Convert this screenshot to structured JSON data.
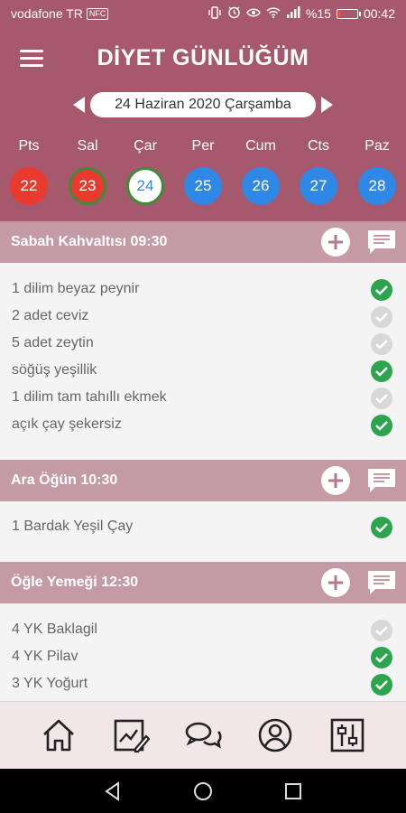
{
  "status_bar": {
    "carrier": "vodafone TR",
    "nfc_badge": "NFC",
    "battery": "%15",
    "battery_level": 0.15,
    "time": "00:42"
  },
  "header": {
    "title": "DİYET GÜNLÜĞÜM",
    "date": "24 Haziran 2020 Çarşamba"
  },
  "week": {
    "labels": [
      "Pts",
      "Sal",
      "Çar",
      "Per",
      "Cum",
      "Cts",
      "Paz"
    ],
    "days": [
      "22",
      "23",
      "24",
      "25",
      "26",
      "27",
      "28"
    ]
  },
  "meals": [
    {
      "title": "Sabah Kahvaltısı 09:30",
      "items": [
        {
          "text": "1 dilim beyaz peynir",
          "checked": true
        },
        {
          "text": "2 adet ceviz",
          "checked": false
        },
        {
          "text": "5 adet zeytin",
          "checked": false
        },
        {
          "text": "söğüş yeşillik",
          "checked": true
        },
        {
          "text": "1 dilim tam tahıllı ekmek",
          "checked": false
        },
        {
          "text": "açık çay şekersiz",
          "checked": true
        }
      ]
    },
    {
      "title": "Ara Öğün 10:30",
      "items": [
        {
          "text": "1 Bardak Yeşil Çay",
          "checked": true
        }
      ]
    },
    {
      "title": "Öğle Yemeği 12:30",
      "items": [
        {
          "text": "4 YK Baklagil",
          "checked": false
        },
        {
          "text": "4 YK Pilav",
          "checked": true
        },
        {
          "text": "3 YK Yoğurt",
          "checked": true
        }
      ]
    }
  ],
  "bottom_nav": [
    "home-icon",
    "diary-chart-icon",
    "chat-icon",
    "profile-icon",
    "settings-sliders-icon"
  ],
  "colors": {
    "primary": "#a6596d",
    "section": "#c49aa5",
    "check_on": "#2da44e",
    "check_off": "#d8d8d8",
    "day_past": "#ea3a2f",
    "day_future": "#2f88e6"
  }
}
